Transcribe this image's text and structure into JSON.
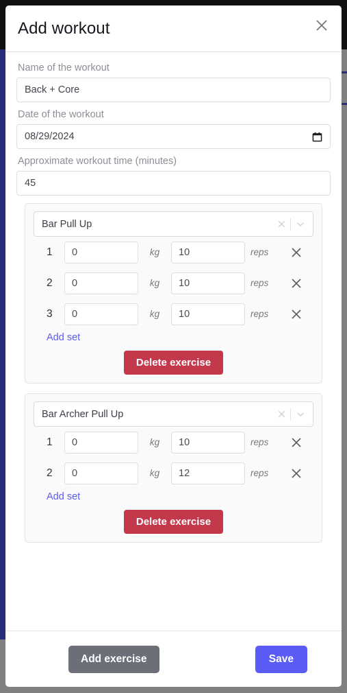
{
  "modal": {
    "title": "Add workout",
    "close_icon": "close-icon"
  },
  "form": {
    "name_label": "Name of the workout",
    "name_value": "Back + Core",
    "name_placeholder": "Name of the workout",
    "date_label": "Date of the workout",
    "date_value": "08/29/2024",
    "date_icon": "calendar-icon",
    "time_label": "Approximate workout time (minutes)",
    "time_value": "45",
    "time_placeholder": "Approximate workout time (minutes)"
  },
  "units": {
    "weight": "kg",
    "reps": "reps"
  },
  "labels": {
    "add_set": "Add set",
    "delete_exercise": "Delete exercise",
    "select_clear_icon": "clear-icon",
    "select_arrow_icon": "chevron-down-icon",
    "set_delete_icon": "close-icon"
  },
  "exercises": [
    {
      "name": "Bar Pull Up",
      "sets": [
        {
          "index": "1",
          "weight": "0",
          "reps": "10"
        },
        {
          "index": "2",
          "weight": "0",
          "reps": "10"
        },
        {
          "index": "3",
          "weight": "0",
          "reps": "10"
        }
      ]
    },
    {
      "name": "Bar Archer Pull Up",
      "sets": [
        {
          "index": "1",
          "weight": "0",
          "reps": "10"
        },
        {
          "index": "2",
          "weight": "0",
          "reps": "12"
        }
      ]
    }
  ],
  "footer": {
    "add_exercise": "Add exercise",
    "save": "Save"
  },
  "colors": {
    "accent": "#5b5bf5",
    "danger": "#c4384c",
    "neutral_button": "#6c6f78",
    "link": "#5b5bf0",
    "backdrop": "#808080",
    "behind_blue": "#2a2d7a"
  }
}
